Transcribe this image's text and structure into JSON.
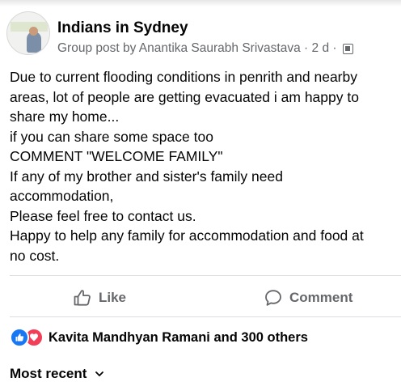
{
  "post": {
    "group_name": "Indians in Sydney",
    "author_line": "Group post by Anantika Saurabh Srivastava",
    "separator": "·",
    "time": "2 d",
    "audience_icon": "members-icon",
    "body_lines": [
      "Due to current flooding conditions in penrith and nearby",
      "areas, lot of people are getting evacuated i am happy to",
      "share my home...",
      "if you can share some space too",
      "COMMENT \"WELCOME FAMILY\"",
      "If any of my brother and sister's family need",
      "accommodation,",
      "Please feel free to contact us.",
      "Happy to help any family for accommodation and food at",
      "no cost."
    ]
  },
  "actions": {
    "like_label": "Like",
    "comment_label": "Comment"
  },
  "reactions": {
    "icons": [
      "like-reaction-icon",
      "love-reaction-icon"
    ],
    "summary": "Kavita Mandhyan Ramani and 300 others"
  },
  "comments": {
    "sort_label": "Most recent"
  },
  "colors": {
    "text": "#050505",
    "secondary": "#65676b",
    "like_blue": "#1877f2",
    "love_red": "#f33e58",
    "divider": "#dadde1"
  }
}
